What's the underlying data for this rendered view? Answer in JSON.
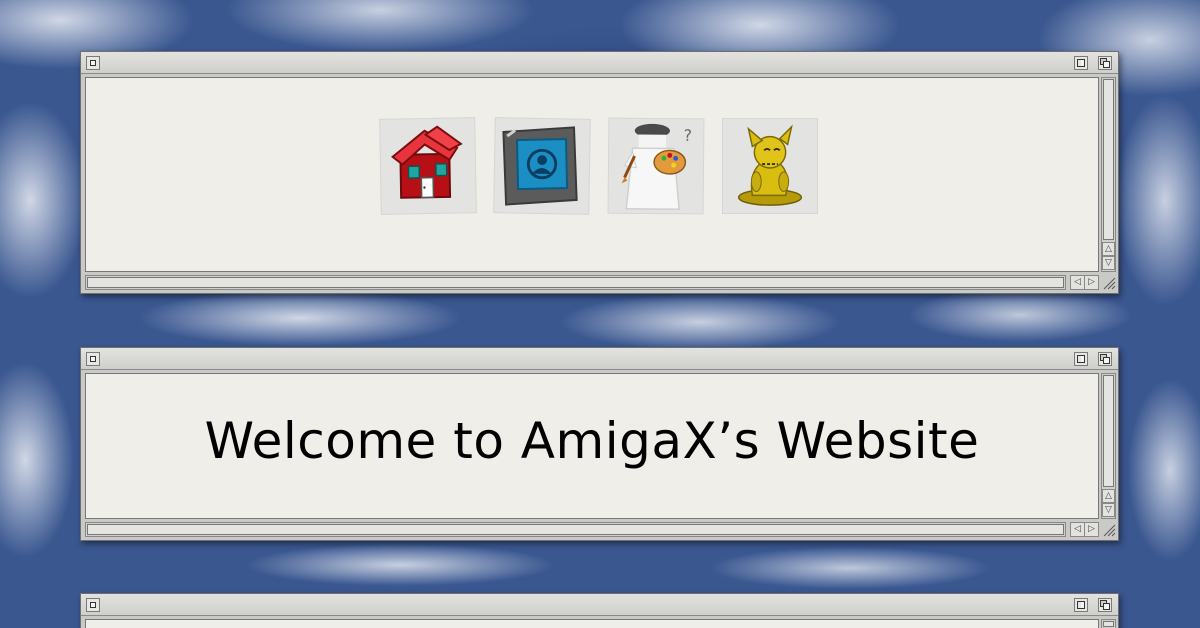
{
  "windows": [
    {
      "id": "icon-window",
      "nav_icons": [
        {
          "name": "home",
          "icon": "house-icon"
        },
        {
          "name": "photo",
          "icon": "photo-frame-icon"
        },
        {
          "name": "art",
          "icon": "painter-palette-icon"
        },
        {
          "name": "trophy",
          "icon": "gold-creature-statue-icon"
        }
      ]
    },
    {
      "id": "welcome-window",
      "heading": "Welcome to AmigaX’s Website"
    },
    {
      "id": "third-window"
    }
  ],
  "scroll_arrows": {
    "up": "△",
    "down": "▽",
    "left": "◁",
    "right": "▷"
  },
  "colors": {
    "content_bg": "#f0eee9",
    "chrome": "#c9c9c6",
    "desktop": "#3a5790"
  }
}
